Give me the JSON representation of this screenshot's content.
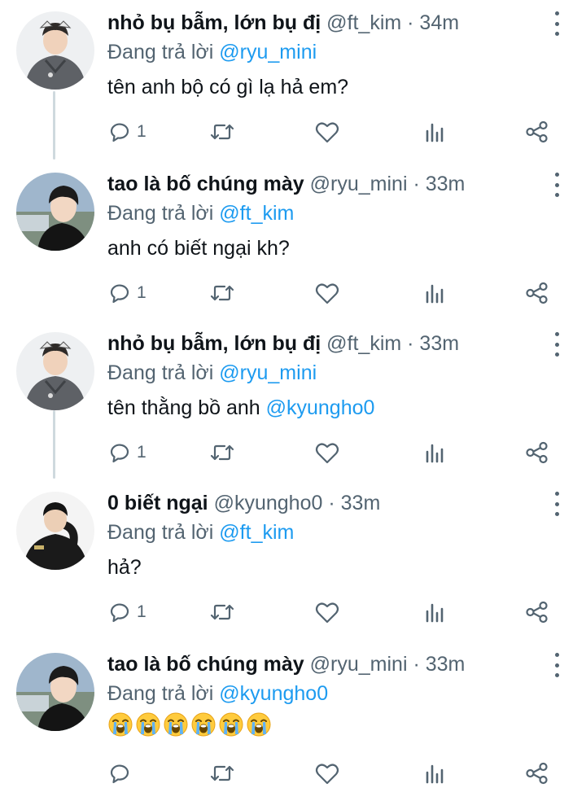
{
  "tweets": [
    {
      "name": "nhỏ bụ bẫm, lớn bụ đị",
      "handle": "@ft_kim",
      "time": "· 34m",
      "replying_prefix": "Đang trả lời",
      "replying_to": "@ryu_mini",
      "text": "tên anh bộ có gì lạ hả em?",
      "reply_count": "1",
      "avatar": "gray-hoodie-user"
    },
    {
      "name": "tao là bố chúng mày",
      "handle": "@ryu_mini",
      "time": "· 33m",
      "replying_prefix": "Đang trả lời",
      "replying_to": "@ft_kim",
      "text": "anh có biết ngại kh?",
      "reply_count": "1",
      "avatar": "black-hair-user"
    },
    {
      "name": "nhỏ bụ bẫm, lớn bụ đị",
      "handle": "@ft_kim",
      "time": "· 33m",
      "replying_prefix": "Đang trả lời",
      "replying_to": "@ryu_mini",
      "text_prefix": "tên thằng bồ anh",
      "text_mention": "@kyungho0",
      "reply_count": "1",
      "avatar": "gray-hoodie-user"
    },
    {
      "name": "0 biết ngại",
      "handle": "@kyungho0",
      "time": "· 33m",
      "replying_prefix": "Đang trả lời",
      "replying_to": "@ft_kim",
      "text": "hả?",
      "reply_count": "1",
      "avatar": "black-jacket-user"
    },
    {
      "name": "tao là bố chúng mày",
      "handle": "@ryu_mini",
      "time": "· 33m",
      "replying_prefix": "Đang trả lời",
      "replying_to": "@kyungho0",
      "emoji": [
        "😭",
        "😭",
        "😭",
        "😭",
        "😭",
        "😭"
      ],
      "emoji_name": "loudly-crying-face",
      "reply_count": "",
      "avatar": "black-hair-user"
    }
  ],
  "icons": [
    "reply-icon",
    "retweet-icon",
    "like-icon",
    "analytics-icon",
    "share-icon",
    "more-icon"
  ],
  "colors": {
    "text": "#0f1419",
    "secondary": "#536471",
    "mention": "#1d9bf0",
    "thread_line": "#cfd9de"
  }
}
